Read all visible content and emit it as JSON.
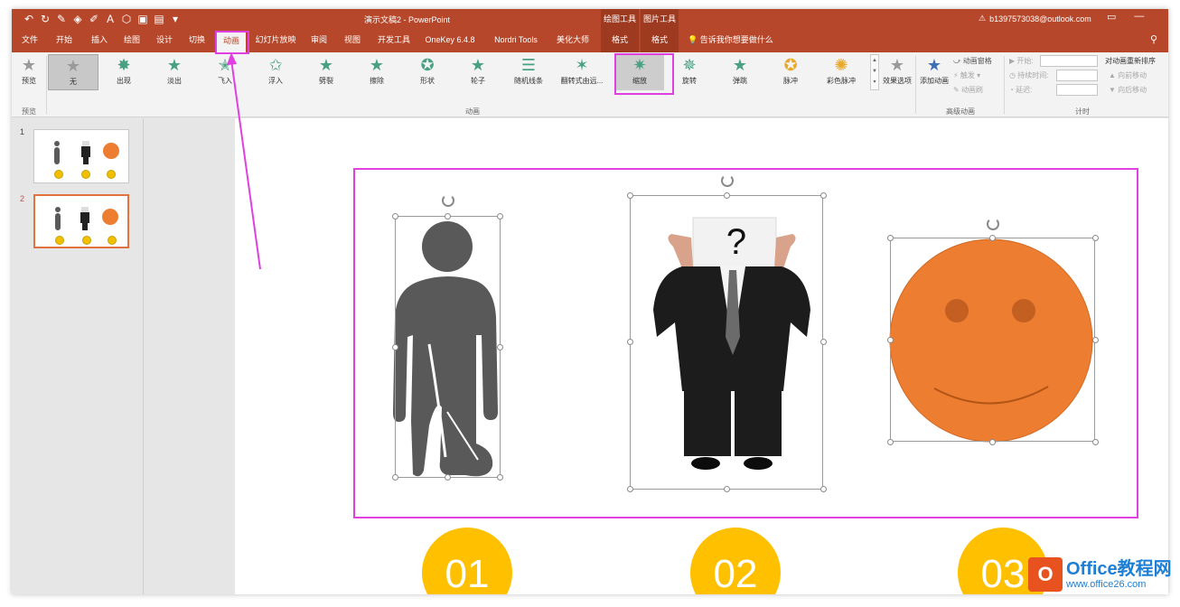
{
  "window": {
    "title": "演示文稿2 - PowerPoint",
    "account": "b1397573038@outlook.com",
    "context_header_draw": "绘图工具",
    "context_header_picture": "图片工具"
  },
  "tabs": [
    {
      "label": "文件"
    },
    {
      "label": "开始"
    },
    {
      "label": "插入"
    },
    {
      "label": "绘图"
    },
    {
      "label": "设计"
    },
    {
      "label": "切换"
    },
    {
      "label": "动画"
    },
    {
      "label": "幻灯片放映"
    },
    {
      "label": "审阅"
    },
    {
      "label": "视图"
    },
    {
      "label": "开发工具"
    },
    {
      "label": "OneKey 6.4.8"
    },
    {
      "label": "Nordri Tools"
    },
    {
      "label": "美化大师"
    },
    {
      "label": "格式"
    },
    {
      "label": "格式"
    }
  ],
  "active_tab": "动画",
  "tell_me": "告诉我你想要做什么",
  "ribbon": {
    "preview_label": "预览",
    "preview_group": "预览",
    "animation_group": "动画",
    "advanced_group": "高级动画",
    "timing_group": "计时",
    "effects": [
      {
        "label": "无",
        "icon": "star-gray-icon",
        "color": "#9a9a9a"
      },
      {
        "label": "出现",
        "icon": "star-burst-icon",
        "color": "#4aa084"
      },
      {
        "label": "淡出",
        "icon": "star-fade-icon",
        "color": "#4aa084"
      },
      {
        "label": "飞入",
        "icon": "star-fly-icon",
        "color": "#4aa084"
      },
      {
        "label": "浮入",
        "icon": "star-float-icon",
        "color": "#4aa084"
      },
      {
        "label": "劈裂",
        "icon": "star-split-icon",
        "color": "#4aa084"
      },
      {
        "label": "擦除",
        "icon": "star-wipe-icon",
        "color": "#4aa084"
      },
      {
        "label": "形状",
        "icon": "star-shape-icon",
        "color": "#4aa084"
      },
      {
        "label": "轮子",
        "icon": "star-wheel-icon",
        "color": "#4aa084"
      },
      {
        "label": "随机线条",
        "icon": "star-lines-icon",
        "color": "#4aa084"
      },
      {
        "label": "翻转式由远...",
        "icon": "star-flip-icon",
        "color": "#4aa084"
      },
      {
        "label": "缩放",
        "icon": "star-zoom-icon",
        "color": "#4aa084"
      },
      {
        "label": "旋转",
        "icon": "star-spin-icon",
        "color": "#4aa084"
      },
      {
        "label": "弹跳",
        "icon": "star-bounce-icon",
        "color": "#4aa084"
      },
      {
        "label": "脉冲",
        "icon": "star-pulse-icon",
        "color": "#e8a82a"
      },
      {
        "label": "彩色脉冲",
        "icon": "star-color-pulse-icon",
        "color": "#e8a82a"
      }
    ],
    "effect_options": "效果选项",
    "add_animation": "添加动画",
    "animation_pane": "动画窗格",
    "trigger": "触发",
    "animation_painter": "动画刷",
    "start_label": "开始:",
    "duration_label": "持续时间:",
    "delay_label": "延迟:",
    "reorder_title": "对动画重新排序",
    "move_earlier": "向前移动",
    "move_later": "向后移动"
  },
  "slides": [
    {
      "number": "1"
    },
    {
      "number": "2"
    }
  ],
  "badges": [
    "01",
    "02",
    "03"
  ],
  "question_mark": "?",
  "watermark": {
    "brand": "Office教程网",
    "url": "www.office26.com",
    "logo_letter": "O"
  },
  "accent_colors": {
    "ribbon": "#b7472a",
    "badge": "#ffc000",
    "smiley": "#ed7d31",
    "annotation": "#e040e0"
  }
}
